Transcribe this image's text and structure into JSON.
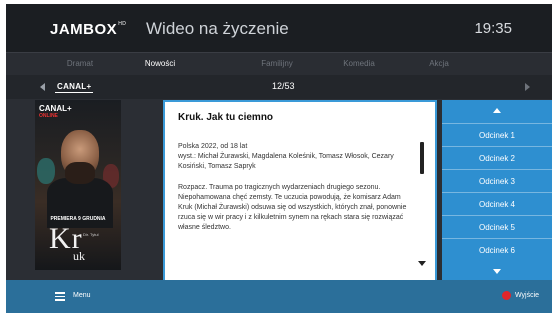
{
  "header": {
    "logo": "JAMBOX",
    "logo_mark": "HD",
    "title": "Wideo na życzenie",
    "clock": "19:35"
  },
  "tabs": [
    "Dramat",
    "Nowości",
    "Familijny",
    "Komedia",
    "Akcja"
  ],
  "active_tab": "Nowości",
  "provider": {
    "name": "CANAL+",
    "page": "12/53"
  },
  "poster": {
    "brand": "CANAL+",
    "brand_sub": "ONLINE",
    "premiere": "PREMIERA 9 GRUDNIA",
    "title_big": "Kr",
    "title_small": "uk",
    "credit": "Dir. Tytul"
  },
  "details": {
    "title": "Kruk. Jak tu ciemno",
    "meta": "Polska 2022, od 18 lat",
    "cast": "wyst.: Michał Żurawski, Magdalena Koleśnik, Tomasz Włosok, Cezary Kosiński, Tomasz Sapryk",
    "description": "Rozpacz. Trauma po tragicznych wydarzeniach drugiego sezonu. Niepohamowana chęć zemsty. Te uczucia powodują, że komisarz Adam Kruk (Michał Żurawski) odsuwa się od wszystkich, których znał, ponownie rzuca się w wir pracy i z kilkuletnim synem na rękach stara się rozwiązać własne śledztwo."
  },
  "episodes": [
    "Odcinek 1",
    "Odcinek 2",
    "Odcinek 3",
    "Odcinek 4",
    "Odcinek 5",
    "Odcinek 6"
  ],
  "footer": {
    "menu_label": "Menu",
    "exit_label": "Wyjście"
  },
  "colors": {
    "accent": "#2e8fd0",
    "footer": "#2b6f9a",
    "exit": "#e0252b"
  }
}
